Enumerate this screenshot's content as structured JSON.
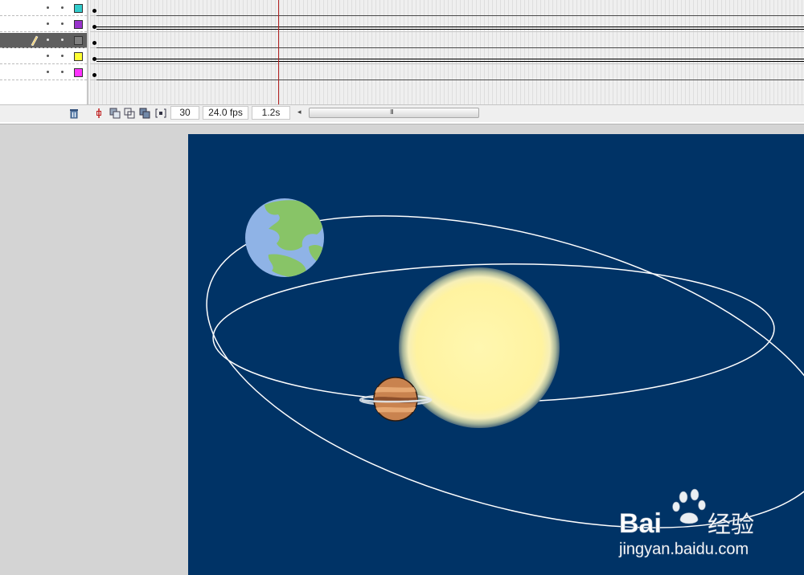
{
  "timeline": {
    "layers": [
      {
        "color": "#33cccc",
        "active": false
      },
      {
        "color": "#9933cc",
        "active": false
      },
      {
        "color": "#808080",
        "active": true
      },
      {
        "color": "#ffff33",
        "active": false
      },
      {
        "color": "#ff33ff",
        "active": false
      }
    ],
    "frame_rows": [
      {
        "type": "keyframe"
      },
      {
        "type": "tween"
      },
      {
        "type": "keyframe"
      },
      {
        "type": "tween"
      },
      {
        "type": "keyframe"
      }
    ],
    "current_frame": "30",
    "frame_rate": "24.0 fps",
    "elapsed_time": "1.2s",
    "scroll_grip": "III",
    "scroll_left_arrow": "◂"
  },
  "stage": {
    "background": "#003366",
    "sun_color": "#fff5a8",
    "earth_ocean": "#8fb3e6",
    "earth_land": "#88c467",
    "jupiter_color": "#c9834f",
    "orbit_color": "#ffffff"
  },
  "watermark": {
    "brand_left": "Bai",
    "brand_right": "经验",
    "url": "jingyan.baidu.com"
  }
}
